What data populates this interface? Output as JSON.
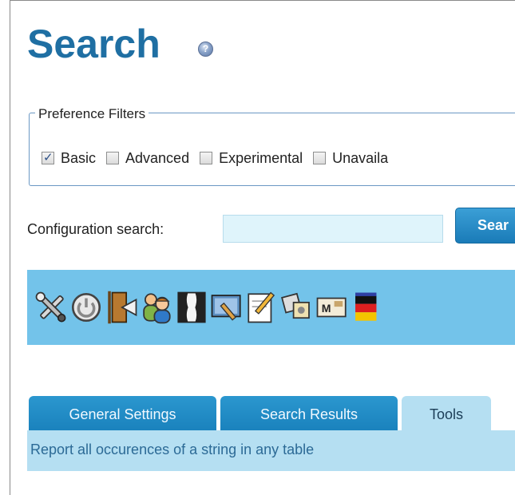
{
  "page": {
    "title": "Search",
    "help_icon": "question-mark-icon"
  },
  "preference_filters": {
    "legend": "Preference Filters",
    "options": [
      {
        "label": "Basic",
        "checked": true
      },
      {
        "label": "Advanced",
        "checked": false
      },
      {
        "label": "Experimental",
        "checked": false
      },
      {
        "label": "Unavaila",
        "checked": false
      }
    ]
  },
  "config_search": {
    "label": "Configuration search:",
    "value": "",
    "button_label": "Sear"
  },
  "toolbar": {
    "background": "#73c3ea",
    "icons": [
      "tools-icon",
      "power-icon",
      "exit-door-icon",
      "users-icon",
      "theme-icon",
      "appearance-icon",
      "edit-icon",
      "plugins-icon",
      "mail-icon",
      "language-flag-icon"
    ]
  },
  "tabs": [
    {
      "label": "General Settings",
      "active": false
    },
    {
      "label": "Search Results",
      "active": false
    },
    {
      "label": "Tools",
      "active": true
    }
  ],
  "tab_panel": {
    "text": "Report all occurences of a string in any table"
  },
  "colors": {
    "title": "#1f6fa3",
    "tab_inactive": "#1a82bd",
    "tab_active": "#b5dff2",
    "button": "#1a7bb8"
  }
}
